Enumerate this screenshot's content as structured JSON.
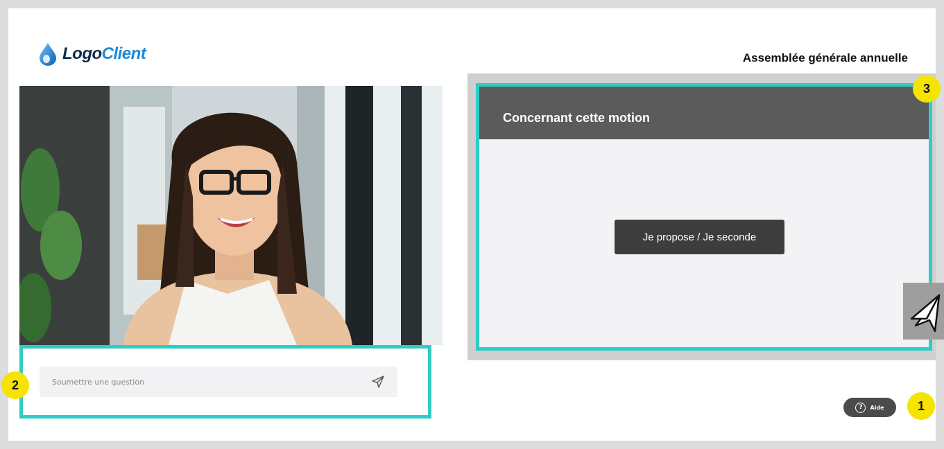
{
  "header": {
    "logo_part1": "Logo",
    "logo_part2": "Client",
    "event_title": "Assemblée générale annuelle"
  },
  "question": {
    "placeholder": "Soumettre une question",
    "send_icon": "send-icon"
  },
  "motion": {
    "header": "Concernant cette motion",
    "button_label": "Je propose / Je seconde"
  },
  "help": {
    "label": "Aide",
    "icon_glyph": "?"
  },
  "badges": [
    "1",
    "2",
    "3"
  ],
  "colors": {
    "accent": "#2ecdc4",
    "badge": "#f5e400",
    "motion_header": "#5b5b5b",
    "button": "#3d3d3d"
  }
}
